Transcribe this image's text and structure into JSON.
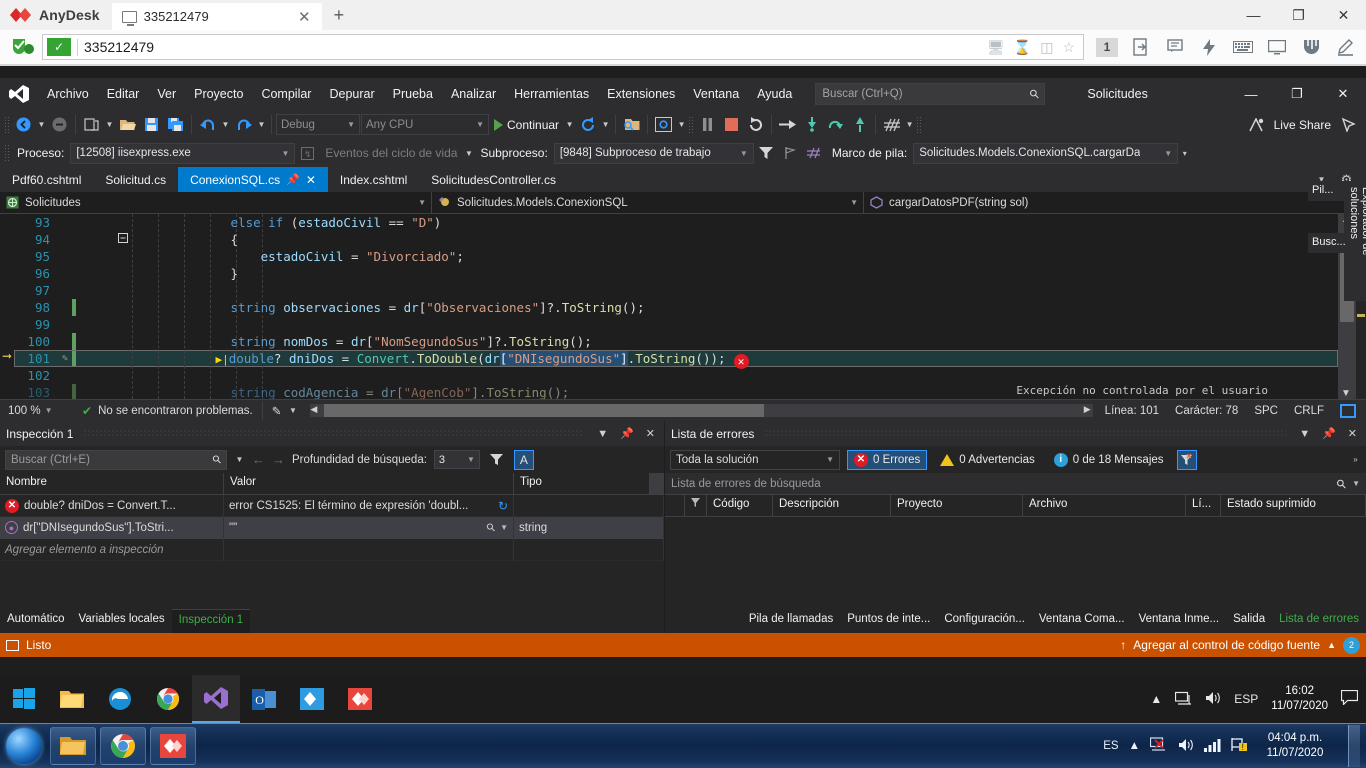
{
  "anydesk": {
    "brand": "AnyDesk",
    "tab_title": "335212479",
    "tab_close": "✕",
    "new_tab": "+",
    "address_value": "335212479",
    "window_buttons": {
      "minimize": "—",
      "maximize": "❐",
      "close": "✕"
    },
    "toolbar_badge": "1",
    "icons": [
      "screen-off-icon",
      "hourglass-icon",
      "clipboard-icon",
      "star-icon",
      "session-count-icon",
      "file-transfer-icon",
      "chat-icon",
      "action-icon",
      "keyboard-icon",
      "monitor-icon",
      "permissions-icon",
      "whiteboard-icon"
    ]
  },
  "vs": {
    "menu": [
      "Archivo",
      "Editar",
      "Ver",
      "Proyecto",
      "Compilar",
      "Depurar",
      "Prueba",
      "Analizar",
      "Herramientas",
      "Extensiones",
      "Ventana",
      "Ayuda"
    ],
    "search_placeholder": "Buscar (Ctrl+Q)",
    "solution_name": "Solicitudes",
    "window_buttons": {
      "minimize": "—",
      "restore": "❐",
      "close": "✕"
    },
    "live_share": "Live Share",
    "toolbar": {
      "config": "Debug",
      "platform": "Any CPU",
      "run_label": "Continuar"
    },
    "debug_bar": {
      "proceso_label": "Proceso:",
      "proceso_value": "[12508] iisexpress.exe",
      "eventos_label": "Eventos del ciclo de vida",
      "subproceso_label": "Subproceso:",
      "subproceso_value": "[9848] Subproceso de trabajo",
      "marco_label": "Marco de pila:",
      "marco_value": "Solicitudes.Models.ConexionSQL.cargarDа"
    },
    "doc_tabs": [
      {
        "label": "Pdf60.cshtml",
        "active": false
      },
      {
        "label": "Solicitud.cs",
        "active": false
      },
      {
        "label": "ConexionSQL.cs",
        "active": true
      },
      {
        "label": "Index.cshtml",
        "active": false
      },
      {
        "label": "SolicitudesController.cs",
        "active": false
      }
    ],
    "nav_bar": {
      "project": "Solicitudes",
      "type": "Solicitudes.Models.ConexionSQL",
      "member": "cargarDatosPDF(string sol)"
    },
    "code_lines": [
      {
        "num": "93",
        "text": "else if (estadoCivil == \"D\")",
        "fold": "−",
        "changed": false
      },
      {
        "num": "94",
        "text": "{",
        "fold": "",
        "changed": false
      },
      {
        "num": "95",
        "text": "estadoCivil = \"Divorciado\";",
        "fold": "",
        "changed": false
      },
      {
        "num": "96",
        "text": "}",
        "fold": "",
        "changed": false
      },
      {
        "num": "97",
        "text": "",
        "fold": "",
        "changed": false
      },
      {
        "num": "98",
        "text": "string observaciones = dr[\"Observaciones\"]?.ToString();",
        "fold": "",
        "changed": true
      },
      {
        "num": "99",
        "text": "",
        "fold": "",
        "changed": false
      },
      {
        "num": "100",
        "text": "string nomDos = dr[\"NomSegundoSus\"]?.ToString();",
        "fold": "",
        "changed": true
      },
      {
        "num": "101",
        "text": "double? dniDos = Convert.ToDouble(dr[\"DNIsegundoSus\"].ToString());",
        "fold": "",
        "changed": true
      },
      {
        "num": "102",
        "text": "",
        "fold": "",
        "changed": false
      },
      {
        "num": "103",
        "text": "string codAgencia = dr[\"AgenCob\"].ToString();",
        "fold": "",
        "changed": true
      }
    ],
    "exception_tooltip": "Excepción no controlada por el usuario",
    "editor_status": {
      "zoom": "100 %",
      "problems": "No se encontraron problemas.",
      "line": "Línea: 101",
      "char": "Carácter: 78",
      "spc": "SPC",
      "crlf": "CRLF"
    },
    "watch_panel": {
      "title": "Inspección 1",
      "search_placeholder": "Buscar (Ctrl+E)",
      "depth_label": "Profundidad de búsqueda:",
      "depth_value": "3",
      "columns": [
        "Nombre",
        "Valor",
        "Tipo"
      ],
      "rows": [
        {
          "icon": "error-icon",
          "name": "double? dniDos = Convert.T...",
          "value": "error CS1525: El término de expresión 'doubl...",
          "type": "",
          "selected": false
        },
        {
          "icon": "clock-icon",
          "name": "dr[\"DNIsegundoSus\"].ToStri...",
          "value": "\"\"",
          "type": "string",
          "selected": true
        }
      ],
      "add_placeholder": "Agregar elemento a inspección"
    },
    "error_panel": {
      "title": "Lista de errores",
      "scope": "Toda la solución",
      "errors": "0 Errores",
      "warnings": "0 Advertencias",
      "messages": "0 de 18 Mensajes",
      "search_placeholder": "Lista de errores de búsqueda",
      "columns": [
        "",
        "",
        "Código",
        "Descripción",
        "Proyecto",
        "Archivo",
        "Lí...",
        "Estado suprimido"
      ]
    },
    "bottom_tabs_left": [
      "Automático",
      "Variables locales",
      "Inspección 1"
    ],
    "bottom_tabs_left_active": "Inspección 1",
    "bottom_tabs_right": [
      "Pila de llamadas",
      "Puntos de inte...",
      "Configuración...",
      "Ventana Coma...",
      "Ventana Inme...",
      "Salida",
      "Lista de errores"
    ],
    "bottom_tabs_right_active": "Lista de errores",
    "status_bar": {
      "state": "Listo",
      "source_control": "Agregar al control de código fuente",
      "badge": "2"
    },
    "side_tabs": [
      "Explorador de soluciones",
      "Pil...",
      "Busc..."
    ]
  },
  "taskbar_remote": {
    "lang": "ESP",
    "time": "16:02",
    "date": "11/07/2020",
    "apps": [
      "start-icon",
      "file-explorer-icon",
      "edge-icon",
      "chrome-icon",
      "visual-studio-icon",
      "outlook-icon",
      "anydesk-launch-icon",
      "anydesk-icon"
    ]
  },
  "taskbar_local": {
    "lang": "ES",
    "time": "04:04 p.m.",
    "date": "11/07/2020",
    "apps": [
      "start-orb-icon",
      "explorer-icon",
      "chrome-icon",
      "anydesk-icon"
    ]
  },
  "colors": {
    "vs_accent": "#007acc",
    "status_orange": "#ca5100",
    "error_red": "#e01b24",
    "warn_yellow": "#f0c419",
    "ok_green": "#3fae49"
  }
}
